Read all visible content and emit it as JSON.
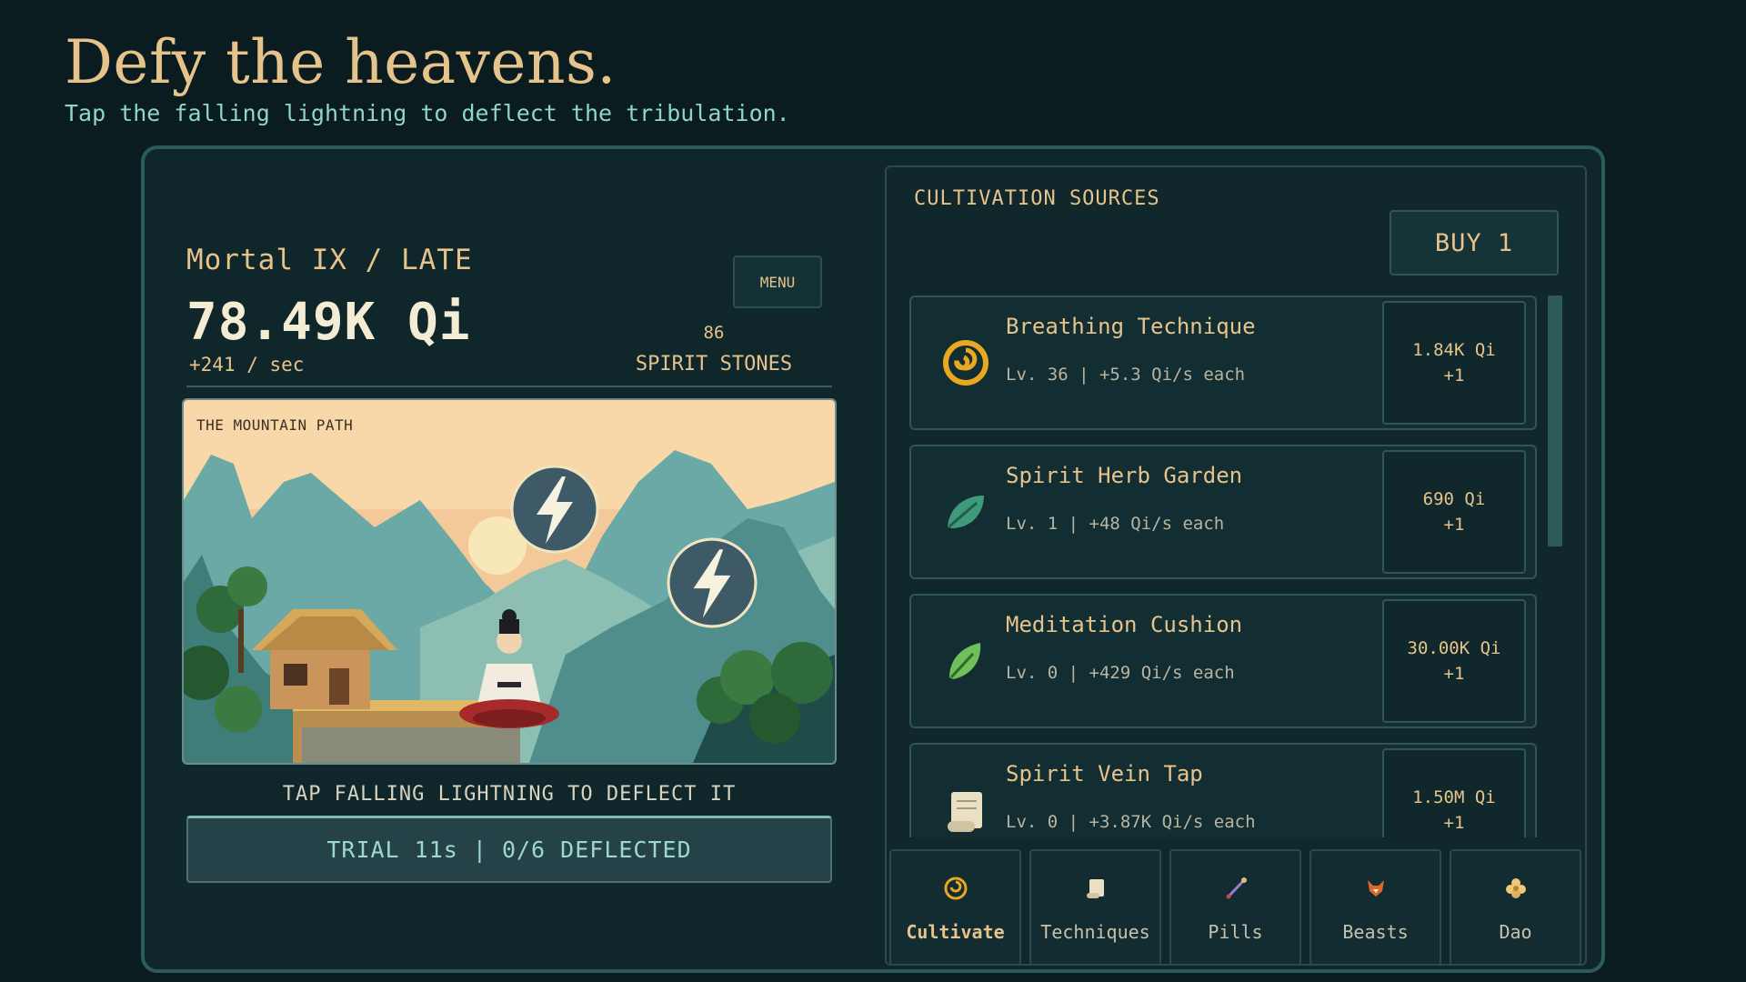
{
  "header": {
    "headline": "Defy the heavens.",
    "subline": "Tap the falling lightning to deflect the tribulation."
  },
  "status": {
    "realm": "Mortal IX  /  LATE",
    "qi": "78.49K Qi",
    "rate": "+241 / sec",
    "menu_label": "MENU",
    "spirit_stones_count": "86",
    "spirit_stones_label": "SPIRIT STONES"
  },
  "scene": {
    "title": "THE MOUNTAIN PATH",
    "hint": "TAP FALLING LIGHTNING TO DEFLECT IT",
    "trial": "TRIAL 11s | 0/6 DEFLECTED",
    "bolt_icon": "lightning-icon"
  },
  "sources": {
    "title": "CULTIVATION SOURCES",
    "buy_label": "BUY 1",
    "items": [
      {
        "name": "Breathing Technique",
        "meta": "Lv. 36  |  +5.3 Qi/s each",
        "cost": "1.84K Qi",
        "qty": "+1",
        "icon": "spiral-icon"
      },
      {
        "name": "Spirit Herb Garden",
        "meta": "Lv. 1  |  +48 Qi/s each",
        "cost": "690 Qi",
        "qty": "+1",
        "icon": "herb-leaf-icon"
      },
      {
        "name": "Meditation Cushion",
        "meta": "Lv. 0  |  +429 Qi/s each",
        "cost": "30.00K Qi",
        "qty": "+1",
        "icon": "leaf-icon"
      },
      {
        "name": "Spirit Vein Tap",
        "meta": "Lv. 0  |  +3.87K Qi/s each",
        "cost": "1.50M Qi",
        "qty": "+1",
        "icon": "scroll-icon"
      }
    ]
  },
  "tabs": [
    {
      "label": "Cultivate",
      "icon": "spiral-icon",
      "active": true
    },
    {
      "label": "Techniques",
      "icon": "scroll-icon",
      "active": false
    },
    {
      "label": "Pills",
      "icon": "brush-icon",
      "active": false
    },
    {
      "label": "Beasts",
      "icon": "fox-icon",
      "active": false
    },
    {
      "label": "Dao",
      "icon": "flower-icon",
      "active": false
    }
  ],
  "colors": {
    "background": "#0b1c21",
    "gold": "#e6c38a",
    "teal": "#8fd6c8",
    "panel": "#10272c"
  }
}
